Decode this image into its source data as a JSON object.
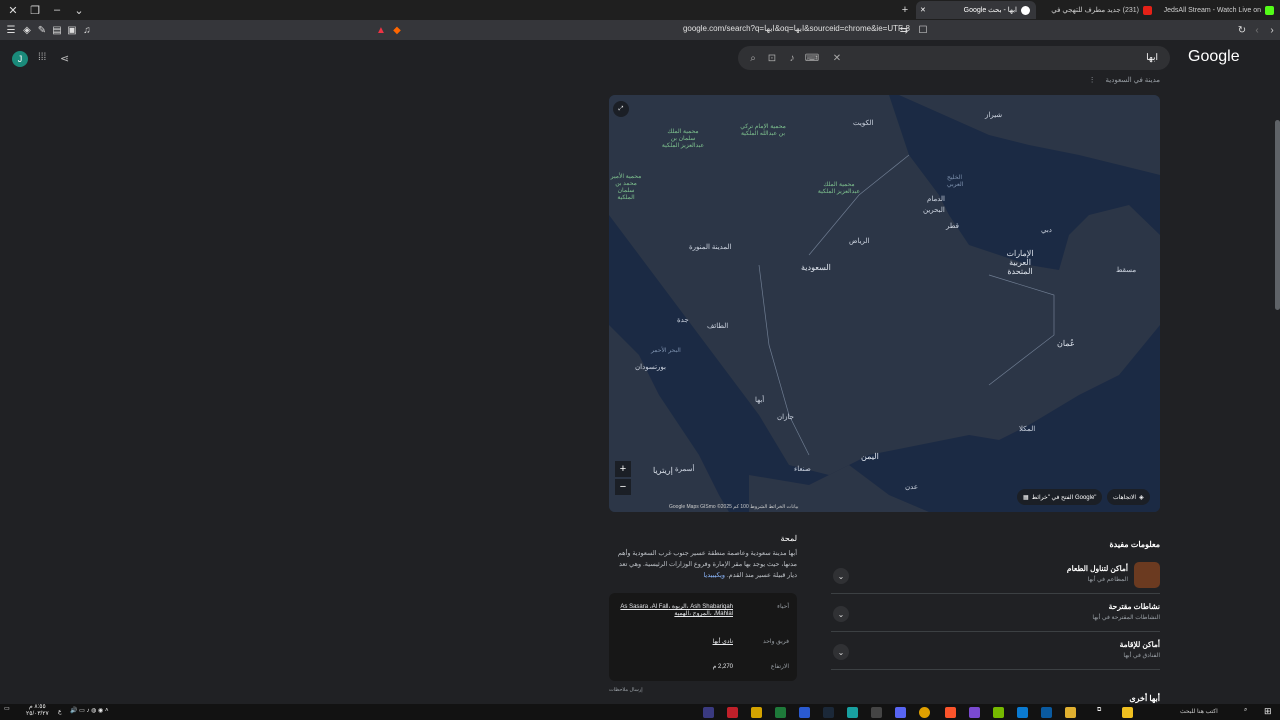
{
  "window": {
    "tabs": [
      {
        "label": "ابها - بحث Google",
        "active": true
      },
      {
        "label": "(231) جديد مطرف للتهجي في",
        "active": false
      },
      {
        "label": "JedsAll Stream - Watch Live on",
        "active": false
      }
    ],
    "url": "google.com/search?q=ابها&oq=ابها&sourceid=chrome&ie=UTF-8"
  },
  "header": {
    "avatar_letter": "J",
    "logo": "Google",
    "search_query": "ابها",
    "subtitle": "مدينة في السعودية"
  },
  "map": {
    "labels": {
      "kuwait": "الكويت",
      "dammam": "الدمام",
      "bahrain": "البحرين",
      "qatar": "قطر",
      "gulf": "الخليج العربي",
      "dubai": "دبي",
      "uae": "الإمارات العربية المتحدة",
      "muscat": "مسقط",
      "riyadh": "الرياض",
      "saudi": "السعودية",
      "madinah": "المدينة المنورة",
      "jeddah": "جدة",
      "taif": "الطائف",
      "red_sea": "البحر الأحمر",
      "port_sudan": "بورتسودان",
      "oman": "عُمان",
      "abha": "أبها",
      "jazan": "جازان",
      "yemen": "اليمن",
      "sanaa": "صنعاء",
      "asmara": "أسمرة",
      "eritrea": "إريتريا",
      "mukalla": "المكلا",
      "aden": "عدن",
      "reserve1": "محمية الملك سلمان بن عبدالعزيز الملكية",
      "reserve2": "محمية الإمام تركي بن عبدالله الملكية",
      "reserve3": "محمية الملك عبدالعزيز الملكية",
      "reserve4": "محمية الأمير محمد بن سلمان الملكية",
      "shiraz": "شيراز"
    },
    "directions_btn": "الاتجاهات",
    "open_maps_btn": "الفتح في \"خرائط Google\"",
    "attribution": "Google Maps GISmo ©2025 بيانات الخرائط  الشروط  100 كم"
  },
  "overview": {
    "heading": "لمحة",
    "text": "أبها مدينة سعودية وعاصمة منطقة عسير جنوب غرب السعودية وأهم مدنها، حيث يوجد بها مقر الإمارة وفروع الوزارات الرئيسية. وهي تعد ديار قبيلة عسير منذ القدم.",
    "wiki_link": "ويكيبيديا",
    "facts": [
      {
        "key": "أحياء",
        "value": "Ash Shabariqah ،الربوة ،As Sasara ،Al Fall ،Mahlal ،المروج ،الهمية"
      },
      {
        "key": "فريق واحد",
        "value": "نادي أبها"
      },
      {
        "key": "الارتفاع",
        "value": "2,270 م"
      }
    ],
    "feedback": "إرسال ملاحظات"
  },
  "useful_info": {
    "title": "معلومات مفيدة",
    "items": [
      {
        "title": "أماكن لتناول الطعام",
        "subtitle": "المطاعم في أبها"
      },
      {
        "title": "نشاطات مقترحة",
        "subtitle": "النشاطات المقترحة في أبها"
      },
      {
        "title": "أماكن للإقامة",
        "subtitle": "الفنادق في أبها"
      }
    ],
    "partial_title": "أبها أخرى"
  },
  "taskbar": {
    "search_placeholder": "اكتب هنا للبحث",
    "clock_time": "٨:٥٥ م",
    "clock_date": "٢٥/٠٣/٢٧",
    "lang": "ع"
  }
}
